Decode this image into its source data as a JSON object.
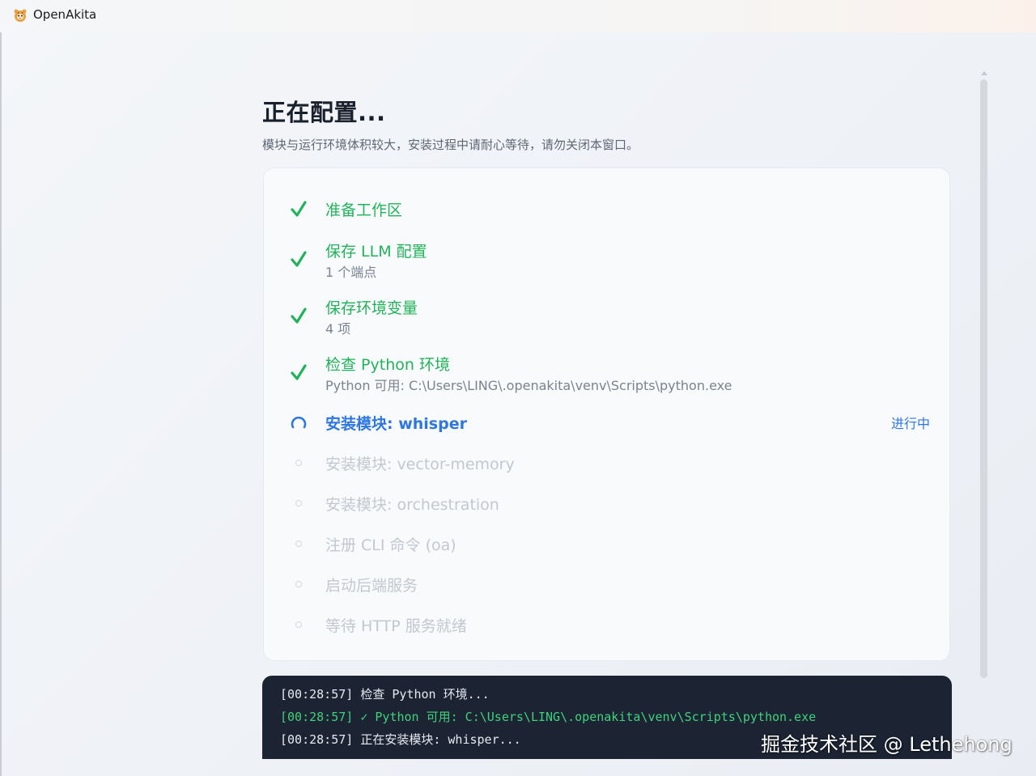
{
  "window": {
    "title": "OpenAkita",
    "icon": "tiger-app-icon"
  },
  "page": {
    "title": "正在配置...",
    "subtitle": "模块与运行环境体积较大，安装过程中请耐心等待，请勿关闭本窗口。"
  },
  "steps": [
    {
      "label": "准备工作区",
      "detail": "",
      "state": "done"
    },
    {
      "label": "保存 LLM 配置",
      "detail": "1 个端点",
      "state": "done"
    },
    {
      "label": "保存环境变量",
      "detail": "4 项",
      "state": "done"
    },
    {
      "label": "检查 Python 环境",
      "detail": "Python 可用: C:\\Users\\LING\\.openakita\\venv\\Scripts\\python.exe",
      "state": "done"
    },
    {
      "label": "安装模块: whisper",
      "detail": "",
      "state": "active",
      "status": "进行中"
    },
    {
      "label": "安装模块: vector-memory",
      "detail": "",
      "state": "pending"
    },
    {
      "label": "安装模块: orchestration",
      "detail": "",
      "state": "pending"
    },
    {
      "label": "注册 CLI 命令 (oa)",
      "detail": "",
      "state": "pending"
    },
    {
      "label": "启动后端服务",
      "detail": "",
      "state": "pending"
    },
    {
      "label": "等待 HTTP 服务就绪",
      "detail": "",
      "state": "pending"
    }
  ],
  "log": {
    "lines": [
      {
        "text": "[00:28:57] 检查 Python 环境...",
        "color": "white"
      },
      {
        "text": "[00:28:57] ✓ Python 可用: C:\\Users\\LING\\.openakita\\venv\\Scripts\\python.exe",
        "color": "green"
      },
      {
        "text": "[00:28:57] 正在安装模块: whisper...",
        "color": "white"
      }
    ]
  },
  "watermark": "掘金技术社区 @ Lethehong",
  "colors": {
    "done": "#22b35a",
    "active": "#2f77e0",
    "pending": "#c3c8d0",
    "log_bg": "#1c2434"
  }
}
